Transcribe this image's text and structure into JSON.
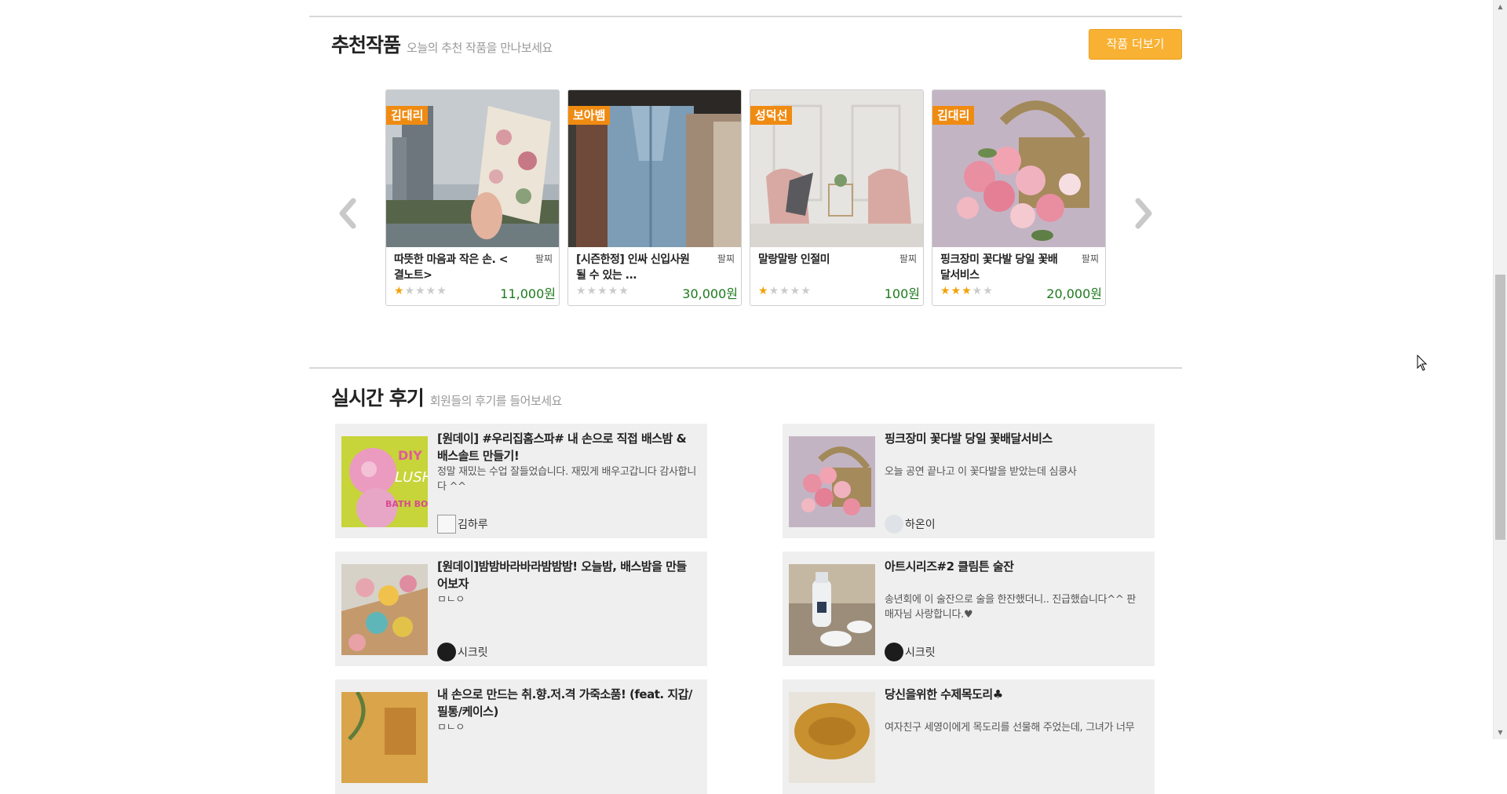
{
  "recommend": {
    "title": "추천작품",
    "subtitle": "오늘의 추천 작품을 만나보세요",
    "more_label": "작품 더보기",
    "prev_icon": "chevron-left-icon",
    "next_icon": "chevron-right-icon",
    "cards": [
      {
        "seller": "김대리",
        "title": "따뜻한 마음과 작은 손. < 결노트>",
        "tag": "팔찌",
        "price": "11,000원",
        "rating": 1
      },
      {
        "seller": "보아뱀",
        "title": "[시즌한정] 인싸 신입사원될 수 있는 ...",
        "tag": "팔찌",
        "price": "30,000원",
        "rating": 0
      },
      {
        "seller": "성덕선",
        "title": "말랑말랑 인절미",
        "tag": "팔찌",
        "price": "100원",
        "rating": 1
      },
      {
        "seller": "김대리",
        "title": "핑크장미 꽃다발 당일 꽃배달서비스",
        "tag": "팔찌",
        "price": "20,000원",
        "rating": 3
      }
    ]
  },
  "reviews": {
    "title": "실시간 후기",
    "subtitle": "회원들의 후기를 들어보세요",
    "items": [
      {
        "title": "[원데이] #우리집홈스파# 내 손으로 직접 배스밤 & 배스솔트 만들기!",
        "text": "정말 재밌는 수업 잘들었습니다. 재밌게 배우고갑니다 감사합니다 ^^",
        "user": "김하루"
      },
      {
        "title": "핑크장미 꽃다발 당일 꽃배달서비스",
        "text": "오늘 공연 끝나고 이 꽃다발을 받았는데 심쿵사",
        "user": "하온이"
      },
      {
        "title": "[원데이]밤밤바라바라밤밤밤! 오늘밤, 배스밤을 만들어보자",
        "text": "ㅁㄴㅇ",
        "user": "시크릿"
      },
      {
        "title": "아트시리즈#2 클림튼 술잔",
        "text": "송년회에 이 술잔으로 술을 한잔했더니.. 진급했습니다^^ 판매자님 사랑합니다.♥",
        "user": "시크릿"
      },
      {
        "title": "내 손으로 만드는 취.향.저.격 가죽소품! (feat. 지갑/필통/케이스)",
        "text": "ㅁㄴㅇ",
        "user": ""
      },
      {
        "title": "당신을위한 수제목도리♣",
        "text": "여자친구 세영이에게 목도리를 선물해 주었는데, 그녀가 너무",
        "user": ""
      }
    ]
  },
  "colors": {
    "accent": "#f8b133",
    "badge": "#f08b12",
    "price": "#1d7a1d",
    "star": "#f2a20a"
  }
}
